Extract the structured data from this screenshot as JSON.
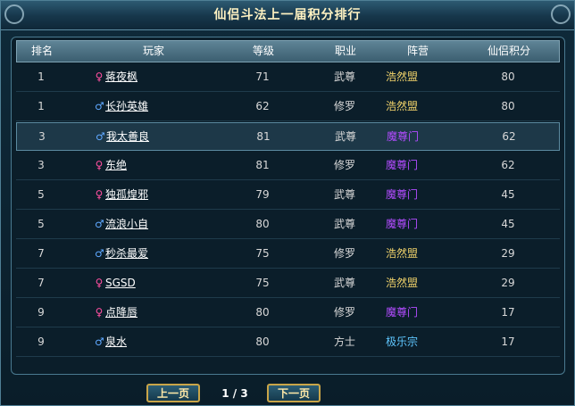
{
  "window": {
    "title": "仙侣斗法上一届积分排行"
  },
  "table": {
    "headers": {
      "rank": "排名",
      "player": "玩家",
      "level": "等级",
      "job": "职业",
      "camp": "阵营",
      "score": "仙侣积分"
    },
    "rows": [
      {
        "rank": "1",
        "gender": "female",
        "gender_glyph": "♀",
        "player": "蒋夜枫",
        "level": "71",
        "job": "武尊",
        "camp": "浩然盟",
        "camp_key": "haoran",
        "score": "80"
      },
      {
        "rank": "1",
        "gender": "male",
        "gender_glyph": "♂",
        "player": "长孙英雄",
        "level": "62",
        "job": "修罗",
        "camp": "浩然盟",
        "camp_key": "haoran",
        "score": "80"
      },
      {
        "rank": "3",
        "gender": "male",
        "gender_glyph": "♂",
        "player": "我太善良",
        "level": "81",
        "job": "武尊",
        "camp": "魔尊门",
        "camp_key": "mozun",
        "score": "62",
        "selected": true
      },
      {
        "rank": "3",
        "gender": "female",
        "gender_glyph": "♀",
        "player": "东绝",
        "level": "81",
        "job": "修罗",
        "camp": "魔尊门",
        "camp_key": "mozun",
        "score": "62"
      },
      {
        "rank": "5",
        "gender": "female",
        "gender_glyph": "♀",
        "player": "独孤煌邪",
        "level": "79",
        "job": "武尊",
        "camp": "魔尊门",
        "camp_key": "mozun",
        "score": "45"
      },
      {
        "rank": "5",
        "gender": "male",
        "gender_glyph": "♂",
        "player": "流浪小自",
        "level": "80",
        "job": "武尊",
        "camp": "魔尊门",
        "camp_key": "mozun",
        "score": "45"
      },
      {
        "rank": "7",
        "gender": "male",
        "gender_glyph": "♂",
        "player": "秒杀最爱",
        "level": "75",
        "job": "修罗",
        "camp": "浩然盟",
        "camp_key": "haoran",
        "score": "29"
      },
      {
        "rank": "7",
        "gender": "female",
        "gender_glyph": "♀",
        "player": "SGSD",
        "level": "75",
        "job": "武尊",
        "camp": "浩然盟",
        "camp_key": "haoran",
        "score": "29"
      },
      {
        "rank": "9",
        "gender": "female",
        "gender_glyph": "♀",
        "player": "点降唇",
        "level": "80",
        "job": "修罗",
        "camp": "魔尊门",
        "camp_key": "mozun",
        "score": "17"
      },
      {
        "rank": "9",
        "gender": "male",
        "gender_glyph": "♂",
        "player": "泉水",
        "level": "80",
        "job": "方士",
        "camp": "极乐宗",
        "camp_key": "jile",
        "score": "17"
      }
    ]
  },
  "pagination": {
    "prev_label": "上一页",
    "next_label": "下一页",
    "page_indicator": "1 / 3"
  },
  "colors": {
    "camp_haoran": "#f0d26a",
    "camp_mozun": "#b24cff",
    "camp_jile": "#5fc7ff",
    "female_icon": "#ff4fa0",
    "male_icon": "#5fa8ff"
  }
}
